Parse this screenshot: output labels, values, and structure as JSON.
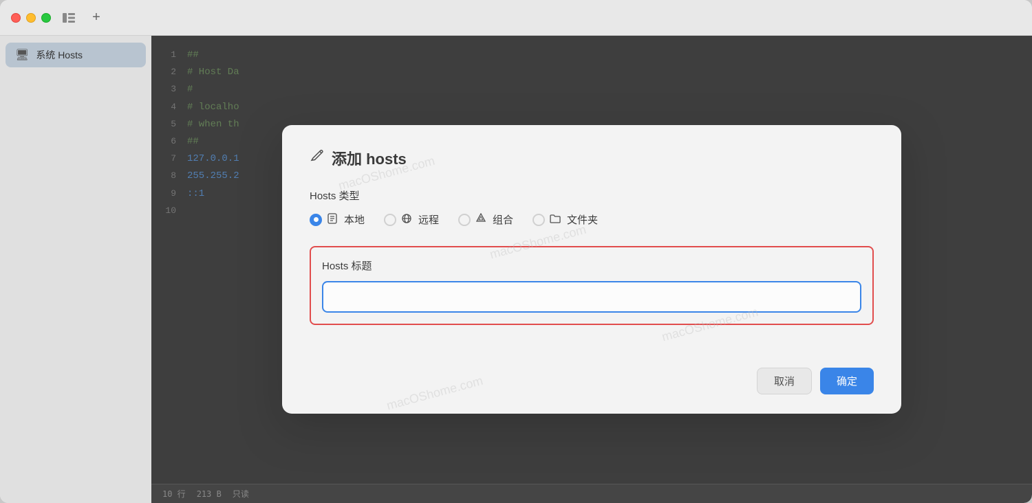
{
  "titleBar": {
    "trafficLights": [
      "close",
      "minimize",
      "maximize"
    ],
    "icons": [
      "sidebar-icon",
      "add-tab-icon"
    ]
  },
  "sidebar": {
    "items": [
      {
        "id": "system-hosts",
        "icon": "🖥",
        "label": "系统 Hosts",
        "active": true
      }
    ]
  },
  "editor": {
    "lines": [
      {
        "number": "1",
        "content": "##",
        "style": "green"
      },
      {
        "number": "2",
        "content": "# Host Da",
        "style": "green"
      },
      {
        "number": "3",
        "content": "#",
        "style": "green"
      },
      {
        "number": "4",
        "content": "# localho",
        "style": "green"
      },
      {
        "number": "5",
        "content": "# when th",
        "style": "green"
      },
      {
        "number": "6",
        "content": "##",
        "style": "green"
      },
      {
        "number": "7",
        "content": "127.0.0.1",
        "style": "blue"
      },
      {
        "number": "8",
        "content": "255.255.2",
        "style": "blue"
      },
      {
        "number": "9",
        "content": "::1",
        "style": "blue"
      },
      {
        "number": "10",
        "content": "",
        "style": "green"
      }
    ],
    "statusBar": {
      "rows": "10 行",
      "size": "213 B",
      "mode": "只读"
    }
  },
  "modal": {
    "title": "添加 hosts",
    "titleIcon": "✎",
    "hostsTypeLabel": "Hosts 类型",
    "radioOptions": [
      {
        "id": "local",
        "icon": "🗒",
        "label": "本地",
        "checked": true
      },
      {
        "id": "remote",
        "icon": "🌐",
        "label": "远程",
        "checked": false
      },
      {
        "id": "group",
        "icon": "◈",
        "label": "组合",
        "checked": false
      },
      {
        "id": "folder",
        "icon": "🗂",
        "label": "文件夹",
        "checked": false
      }
    ],
    "hostsTitleLabel": "Hosts 标题",
    "hostsTitlePlaceholder": "",
    "cancelBtn": "取消",
    "confirmBtn": "确定",
    "watermarks": [
      "macOShome.com",
      "macOShome.com",
      "macOShome.com"
    ]
  }
}
